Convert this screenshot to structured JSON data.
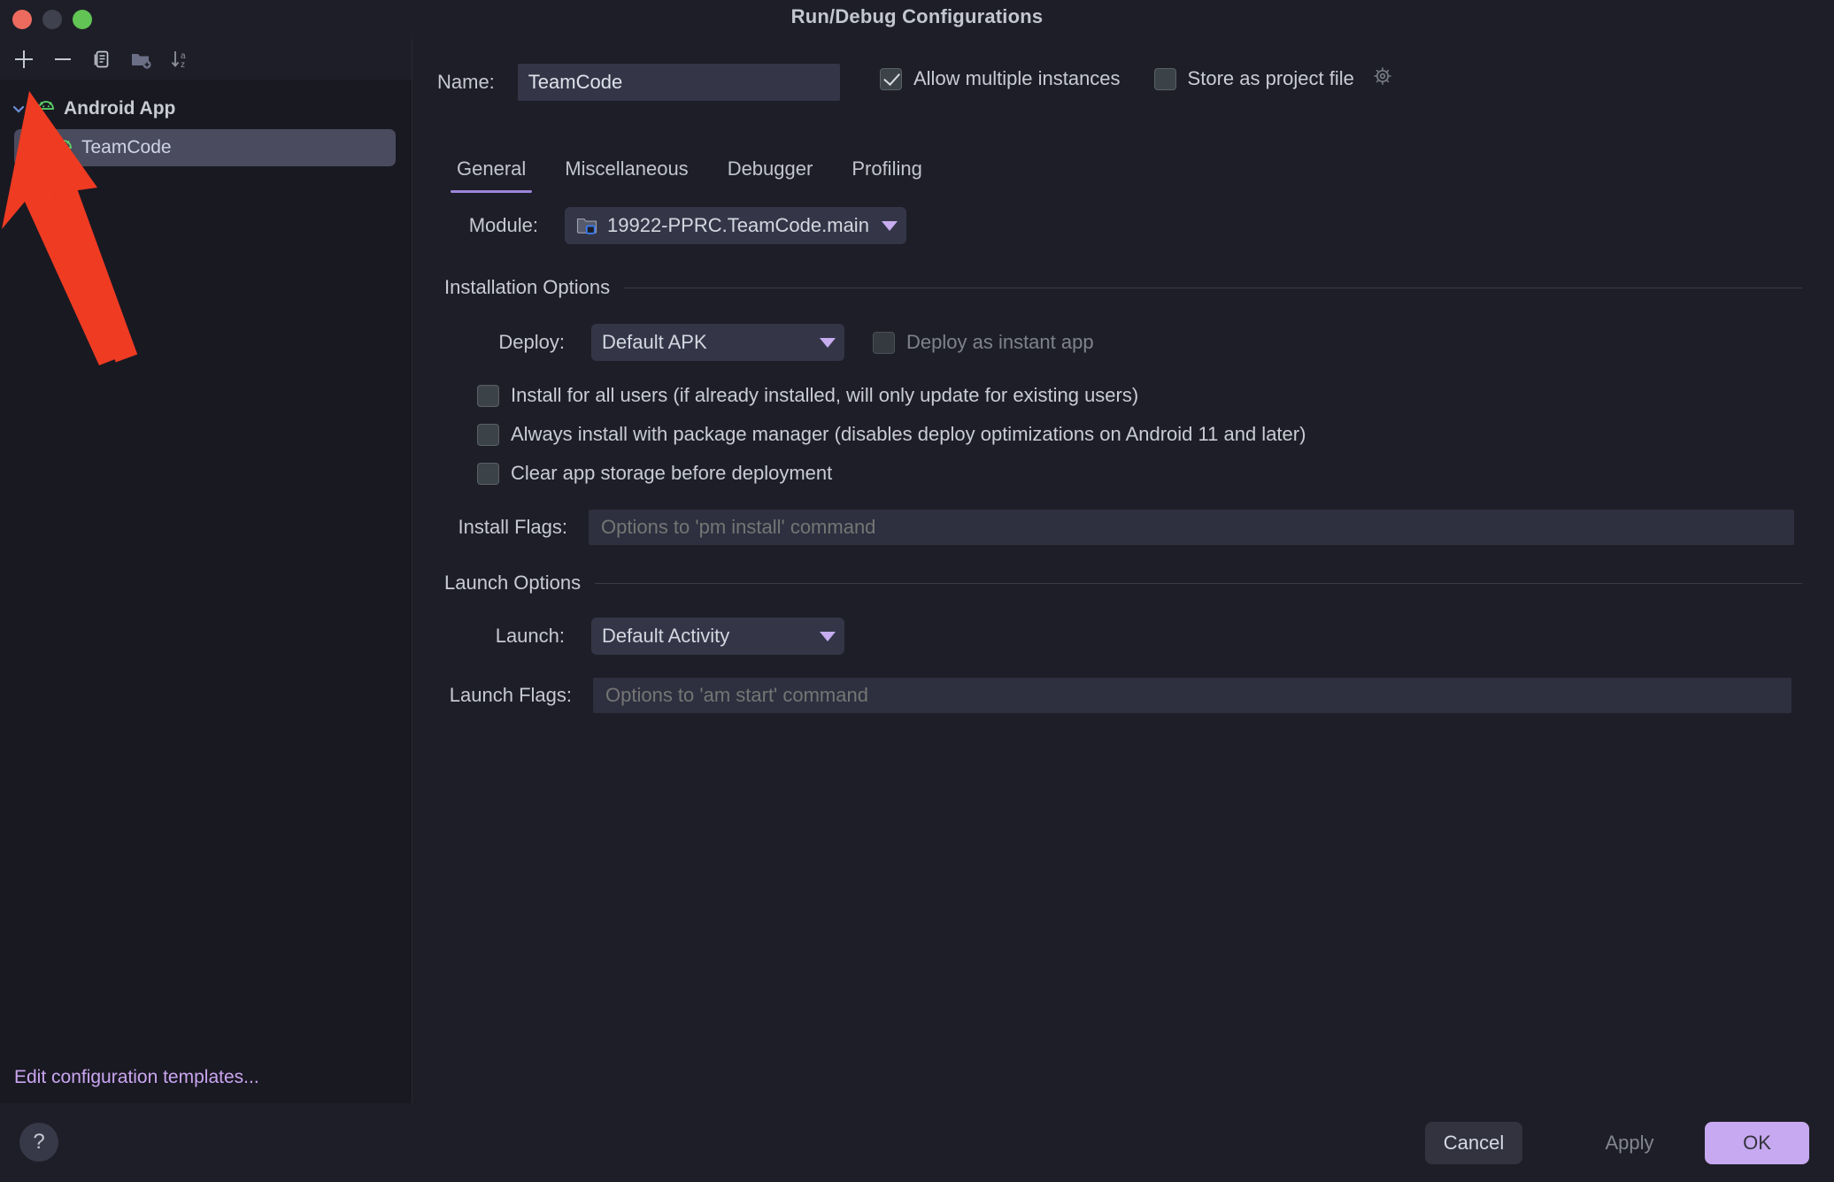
{
  "window": {
    "title": "Run/Debug Configurations",
    "traffic_lights": [
      "close",
      "minimize",
      "zoom"
    ]
  },
  "left_panel": {
    "toolbar": [
      {
        "name": "add-configuration-button",
        "icon": "plus-icon"
      },
      {
        "name": "remove-configuration-button",
        "icon": "minus-icon"
      },
      {
        "name": "copy-configuration-button",
        "icon": "copy-icon"
      },
      {
        "name": "new-folder-button",
        "icon": "folder-add-icon"
      },
      {
        "name": "sort-configurations-button",
        "icon": "sort-az-icon"
      }
    ],
    "tree": [
      {
        "label": "Android App",
        "icon": "android-icon",
        "type": "group",
        "expanded": true,
        "selected": false
      },
      {
        "label": "TeamCode",
        "icon": "android-icon",
        "type": "child",
        "expanded": false,
        "selected": true
      }
    ],
    "footer_link": "Edit configuration templates..."
  },
  "header": {
    "name_label": "Name:",
    "name_value": "TeamCode",
    "name_placeholder": "",
    "allow_multiple_instances": {
      "label": "Allow multiple instances",
      "checked": true
    },
    "store_as_project_file": {
      "label": "Store as project file",
      "checked": false,
      "gear_icon": "gear-icon"
    }
  },
  "tabs": [
    {
      "label": "General",
      "active": true
    },
    {
      "label": "Miscellaneous",
      "active": false
    },
    {
      "label": "Debugger",
      "active": false
    },
    {
      "label": "Profiling",
      "active": false
    }
  ],
  "general": {
    "module": {
      "label": "Module:",
      "value": "19922-PPRC.TeamCode.main",
      "icon": "module-folder-icon"
    },
    "installation_options": {
      "title": "Installation Options",
      "deploy": {
        "label": "Deploy:",
        "value": "Default APK"
      },
      "deploy_as_instant_app": {
        "label": "Deploy as instant app",
        "checked": false,
        "disabled": true
      },
      "checkboxes": [
        {
          "label": "Install for all users (if already installed, will only update for existing users)",
          "checked": false
        },
        {
          "label": "Always install with package manager (disables deploy optimizations on Android 11 and later)",
          "checked": false
        },
        {
          "label": "Clear app storage before deployment",
          "checked": false
        }
      ],
      "install_flags": {
        "label": "Install Flags:",
        "value": "",
        "placeholder": "Options to 'pm install' command"
      }
    },
    "launch_options": {
      "title": "Launch Options",
      "launch": {
        "label": "Launch:",
        "value": "Default Activity"
      },
      "launch_flags": {
        "label": "Launch Flags:",
        "value": "",
        "placeholder": "Options to 'am start' command"
      }
    }
  },
  "footer": {
    "help_label": "?",
    "cancel_label": "Cancel",
    "apply_label": "Apply",
    "apply_disabled": true,
    "ok_label": "OK"
  },
  "annotation": {
    "type": "arrow",
    "color": "#ee3b22",
    "points_to": "add-configuration-button"
  },
  "colors": {
    "accent_purple": "#c6a9f0",
    "tab_underline": "#9c86d8",
    "android_green": "#5ed469",
    "link_purple": "#caa6f0",
    "panel_bg": "#191922",
    "window_bg": "#1e1e28",
    "field_bg": "#343648",
    "arrow_red": "#ee3b22"
  }
}
